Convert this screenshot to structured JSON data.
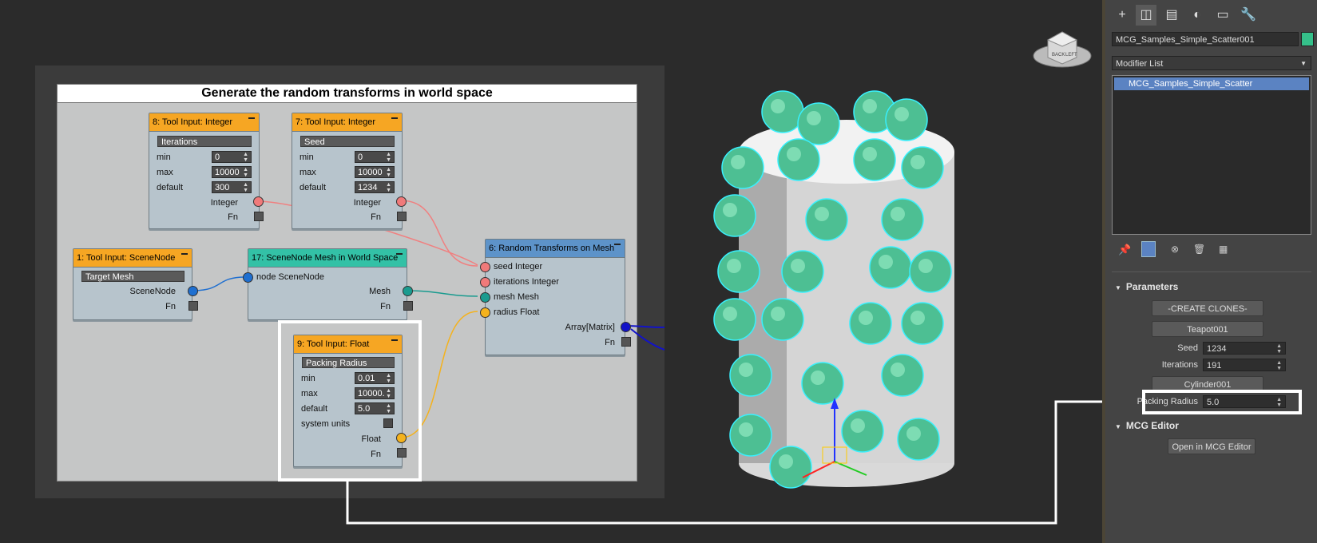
{
  "graph": {
    "title": "Generate the random transforms in world space",
    "nodes": {
      "n8": {
        "title": "8: Tool Input: Integer",
        "name": "Iterations",
        "min_label": "min",
        "min": "0",
        "max_label": "max",
        "max": "10000",
        "default_label": "default",
        "default": "300",
        "out": "Integer",
        "fn": "Fn"
      },
      "n7": {
        "title": "7: Tool Input: Integer",
        "name": "Seed",
        "min_label": "min",
        "min": "0",
        "max_label": "max",
        "max": "10000",
        "default_label": "default",
        "default": "1234",
        "out": "Integer",
        "fn": "Fn"
      },
      "n1": {
        "title": "1: Tool Input: SceneNode",
        "name": "Target Mesh",
        "out": "SceneNode",
        "fn": "Fn"
      },
      "n17": {
        "title": "17: SceneNode Mesh in World Space",
        "in": "node SceneNode",
        "out": "Mesh",
        "fn": "Fn"
      },
      "n6": {
        "title": "6: Random Transforms on Mesh",
        "in1": "seed Integer",
        "in2": "iterations Integer",
        "in3": "mesh Mesh",
        "in4": "radius Float",
        "out": "Array[Matrix]",
        "fn": "Fn"
      },
      "n9": {
        "title": "9: Tool Input: Float",
        "name": "Packing Radius",
        "min_label": "min",
        "min": "0.01",
        "max_label": "max",
        "max": "10000.",
        "default_label": "default",
        "default": "5.0",
        "sys_label": "system units",
        "out": "Float",
        "fn": "Fn"
      }
    }
  },
  "viewport": {
    "cube_labels": [
      "BACK",
      "LEFT"
    ]
  },
  "command_panel": {
    "tabs": [
      "create-icon",
      "modify-icon",
      "hierarchy-icon",
      "motion-icon",
      "display-icon",
      "utilities-icon"
    ],
    "object_name": "MCG_Samples_Simple_Scatter001",
    "object_color": "#35c08a",
    "modifier_list": "Modifier List",
    "stack_item": "MCG_Samples_Simple_Scatter",
    "parameters": {
      "title": "Parameters",
      "create_clones": "-CREATE CLONES-",
      "source": "Teapot001",
      "seed_label": "Seed",
      "seed": "1234",
      "iterations_label": "Iterations",
      "iterations": "191",
      "target": "Cylinder001",
      "radius_label": "Packing Radius",
      "radius": "5.0"
    },
    "mcg_editor": {
      "title": "MCG Editor",
      "open_button": "Open in MCG Editor"
    }
  }
}
